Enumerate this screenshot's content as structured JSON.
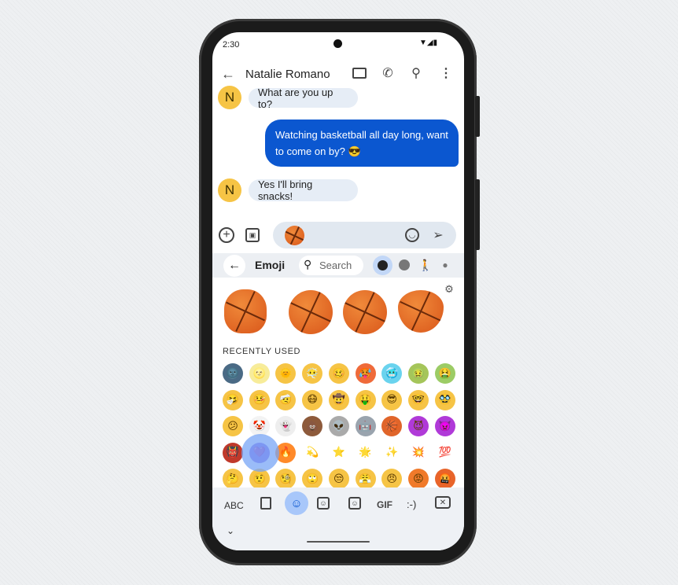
{
  "status": {
    "time": "2:30"
  },
  "header": {
    "contact_name": "Natalie Romano"
  },
  "messages": [
    {
      "from": "in",
      "avatar": "N",
      "text": "What are you up to?"
    },
    {
      "from": "out",
      "text": "Watching basketball all day long, want to come on by? 😎"
    },
    {
      "from": "in",
      "avatar": "N",
      "text": "Yes I'll bring snacks!"
    }
  ],
  "compose": {
    "content_emoji": "🏀"
  },
  "emoji_panel": {
    "title": "Emoji",
    "search_placeholder": "Search",
    "section_label": "RECENTLY USED",
    "stickers": [
      "ghost-basketball",
      "frown-basketball",
      "pleading-basketball",
      "heart-basketball"
    ],
    "recent": [
      "🌚",
      "🌝",
      "🌞",
      "😶‍🌫️",
      "🥴",
      "🥵",
      "🥶",
      "🤢",
      "🤮",
      "🤧",
      "🤒",
      "🤕",
      "😷",
      "🤠",
      "🤑",
      "😎",
      "🤓",
      "🥸",
      "😕",
      "🤡",
      "👻",
      "💩",
      "👽",
      "🤖",
      "🏀",
      "😈",
      "👿",
      "👹",
      "💜",
      "🔥",
      "💫",
      "⭐",
      "🌟",
      "✨",
      "💥",
      "💯",
      "🤔",
      "🤨",
      "🧐",
      "🙄",
      "😒",
      "😤",
      "😠",
      "😡",
      "🤬"
    ],
    "highlighted": "💜"
  },
  "keyboard_bar": {
    "abc": "ABC",
    "gif": "GIF",
    "emoticon": ":-)"
  },
  "colors": {
    "accent": "#0b57d0",
    "avatar": "#f6c445",
    "selected": "#c2d7f7"
  }
}
